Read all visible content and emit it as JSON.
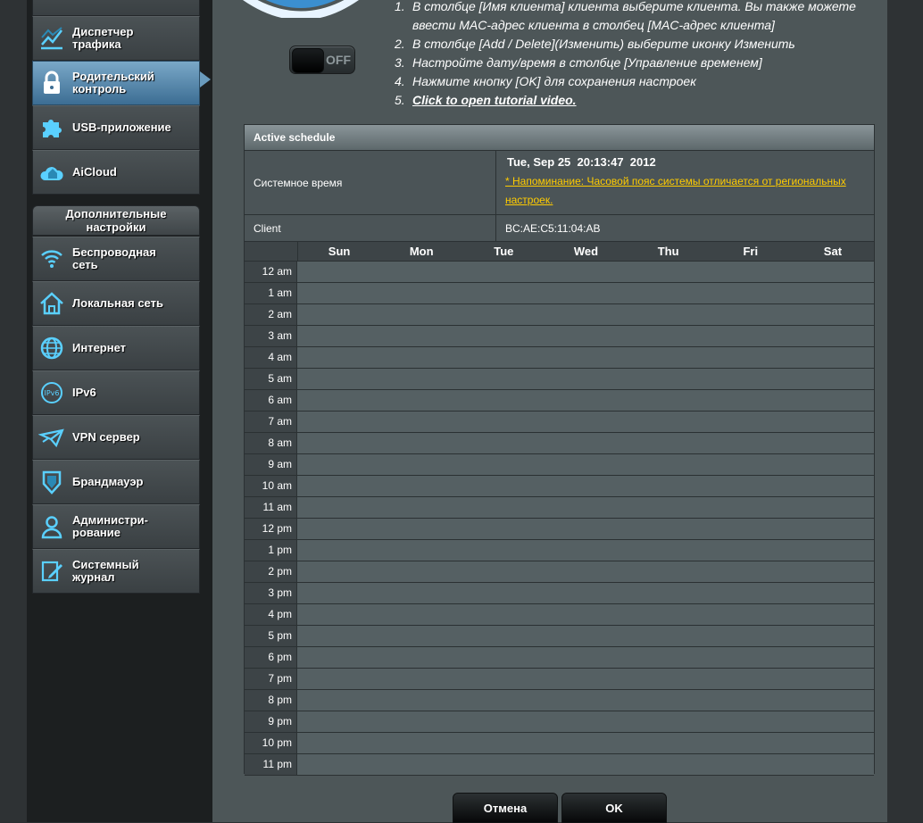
{
  "sidebar": {
    "general_items": [
      {
        "label": "Диспетчер\nтрафика",
        "icon": "traffic-chart-icon"
      },
      {
        "label": "Родительский\nконтроль",
        "icon": "lock-icon",
        "active": true
      },
      {
        "label": "USB-приложение",
        "icon": "puzzle-icon"
      },
      {
        "label": "AiCloud",
        "icon": "cloud-house-icon"
      }
    ],
    "advanced_header": "Дополнительные\nнастройки",
    "advanced_items": [
      {
        "label": "Беспроводная\nсеть",
        "icon": "wifi-icon"
      },
      {
        "label": "Локальная сеть",
        "icon": "home-icon"
      },
      {
        "label": "Интернет",
        "icon": "globe-icon"
      },
      {
        "label": "IPv6",
        "icon": "ipv6-globe-icon"
      },
      {
        "label": "VPN сервер",
        "icon": "vpn-plane-icon"
      },
      {
        "label": "Брандмауэр",
        "icon": "shield-icon"
      },
      {
        "label": "Администри-\nрование",
        "icon": "admin-user-icon"
      },
      {
        "label": "Системный\nжурнал",
        "icon": "log-edit-icon"
      }
    ],
    "accent_color": "#3c6d93"
  },
  "toggle": {
    "state": "OFF"
  },
  "instructions": [
    {
      "num": "1.",
      "text": "В столбце [Имя клиента] клиента выберите клиента. Вы также можете ввести MAC-адрес клиента в столбец [MAC-адрес клиента]"
    },
    {
      "num": "2.",
      "text": "В столбце [Add / Delete](Изменить) выберите иконку Изменить"
    },
    {
      "num": "3.",
      "text": "Настройте дату/время в столбце [Управление временем]"
    },
    {
      "num": "4.",
      "text": "Нажмите кнопку [OK] для сохранения настроек"
    },
    {
      "num": "5.",
      "text": "Click to open tutorial video.",
      "link": true
    }
  ],
  "schedule": {
    "title": "Active schedule",
    "system_time_label": "Системное время",
    "system_time": "Tue, Sep 25  20:13:47  2012",
    "tz_warning": "* Напоминание: Часовой пояс системы отличается от региональных настроек.",
    "client_label": "Client",
    "client_mac": "BC:AE:C5:11:04:AB",
    "days": [
      "Sun",
      "Mon",
      "Tue",
      "Wed",
      "Thu",
      "Fri",
      "Sat"
    ],
    "hours": [
      "12 am",
      "1 am",
      "2 am",
      "3 am",
      "4 am",
      "5 am",
      "6 am",
      "7 am",
      "8 am",
      "9 am",
      "10 am",
      "11 am",
      "12 pm",
      "1 pm",
      "2 pm",
      "3 pm",
      "4 pm",
      "5 pm",
      "6 pm",
      "7 pm",
      "8 pm",
      "9 pm",
      "10 pm",
      "11 pm"
    ],
    "warning_color": "#ffcc00"
  },
  "buttons": {
    "cancel": "Отмена",
    "ok": "OK"
  }
}
